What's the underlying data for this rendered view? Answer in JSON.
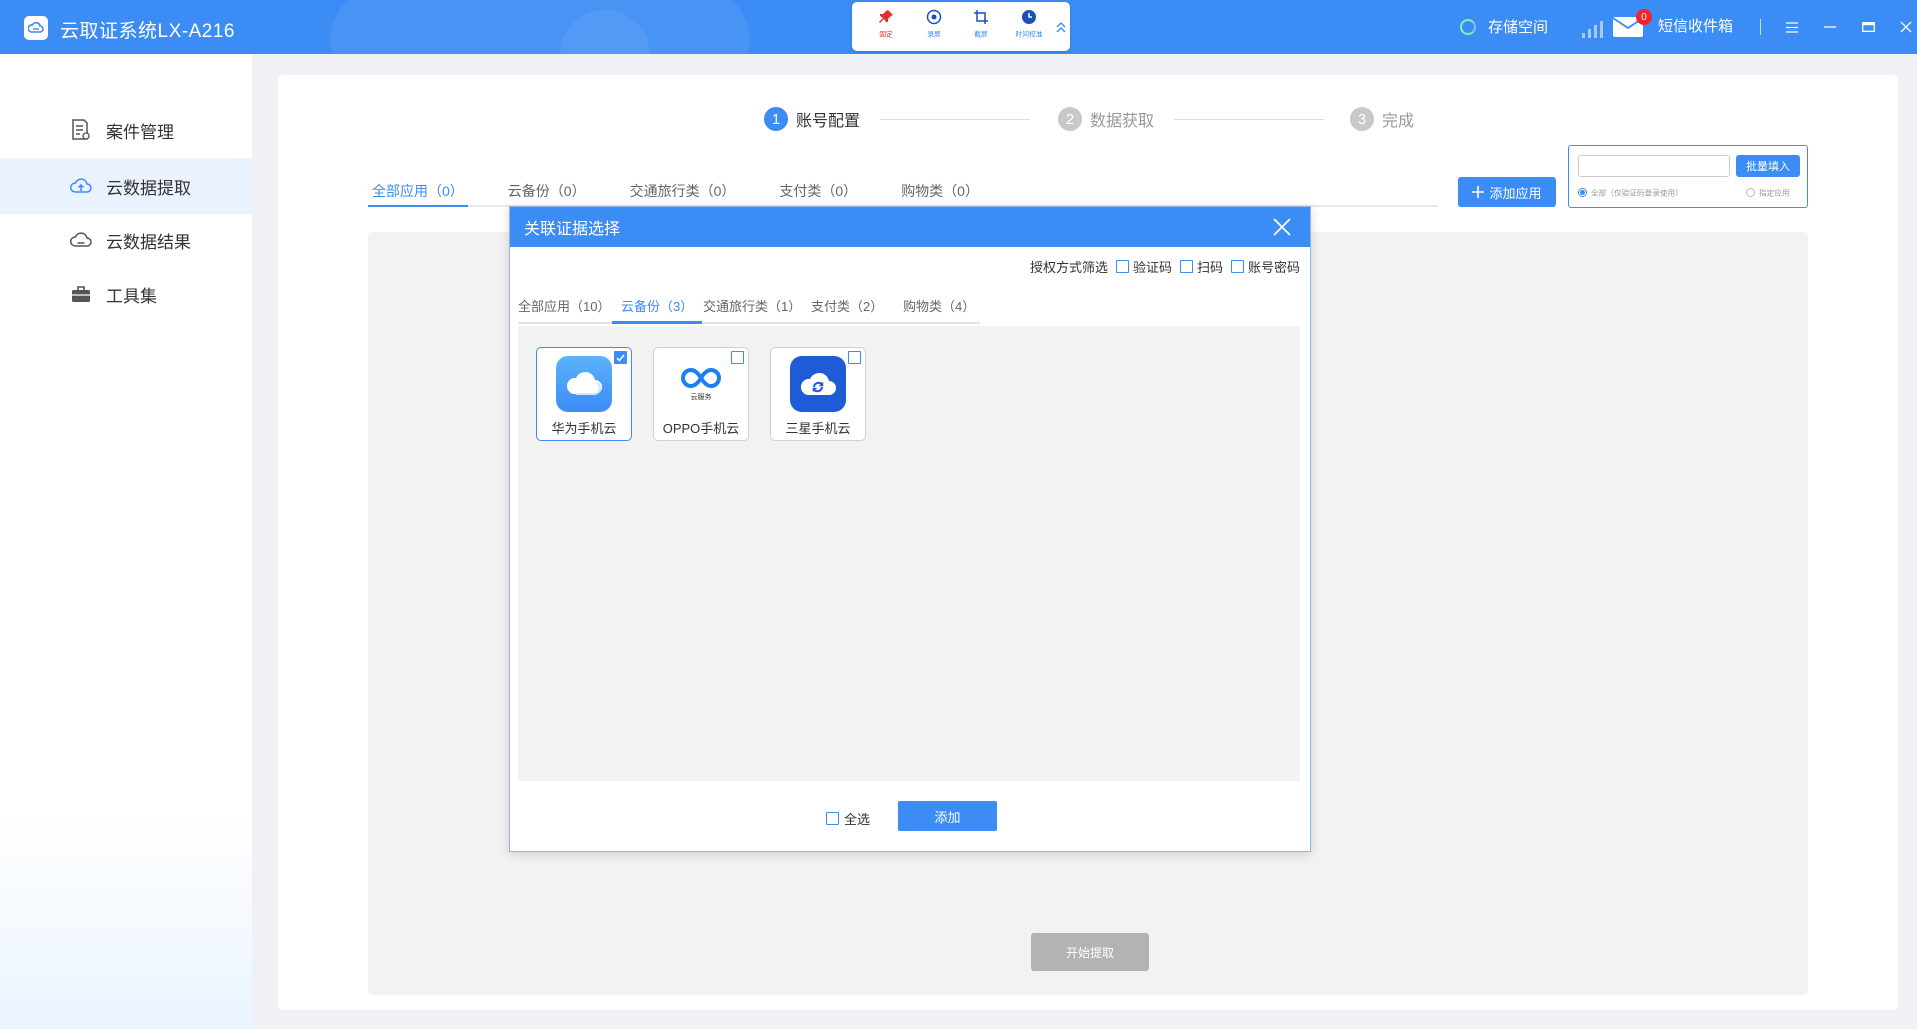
{
  "app": {
    "title": "云取证系统LX-A216"
  },
  "toolbar": {
    "items": [
      {
        "label": "固定",
        "icon": "pin-icon",
        "active": true
      },
      {
        "label": "录屏",
        "icon": "record-icon",
        "active": false
      },
      {
        "label": "截屏",
        "icon": "crop-icon",
        "active": false
      },
      {
        "label": "时间校准",
        "icon": "clock-icon",
        "active": false
      }
    ]
  },
  "header": {
    "storage_label": "存储空间",
    "sms_label": "短信收件箱",
    "sms_badge": "0"
  },
  "sidebar": {
    "items": [
      {
        "label": "案件管理",
        "icon": "case-document-icon",
        "active": false
      },
      {
        "label": "云数据提取",
        "icon": "cloud-upload-icon",
        "active": true
      },
      {
        "label": "云数据结果",
        "icon": "cloud-result-icon",
        "active": false
      },
      {
        "label": "工具集",
        "icon": "toolbox-icon",
        "active": false
      }
    ]
  },
  "steps": [
    {
      "num": "1",
      "label": "账号配置",
      "active": true
    },
    {
      "num": "2",
      "label": "数据获取",
      "active": false
    },
    {
      "num": "3",
      "label": "完成",
      "active": false
    }
  ],
  "main": {
    "tabs": [
      {
        "label": "全部应用（0）",
        "active": true
      },
      {
        "label": "云备份（0）",
        "active": false
      },
      {
        "label": "交通旅行类（0）",
        "active": false
      },
      {
        "label": "支付类（0）",
        "active": false
      },
      {
        "label": "购物类（0）",
        "active": false
      }
    ],
    "add_app_label": "添加应用",
    "batch": {
      "input_value": "",
      "button_label": "批量填入",
      "radio_all": "全部（仅验证码登录使用）",
      "radio_selected": "指定应用"
    },
    "start_label": "开始提取"
  },
  "modal": {
    "title": "关联证据选择",
    "filter_label": "授权方式筛选",
    "filters": [
      "验证码",
      "扫码",
      "账号密码"
    ],
    "tabs": [
      {
        "label": "全部应用（10）",
        "active": false
      },
      {
        "label": "云备份（3）",
        "active": true
      },
      {
        "label": "交通旅行类（1）",
        "active": false
      },
      {
        "label": "支付类（2）",
        "active": false
      },
      {
        "label": "购物类（4）",
        "active": false
      }
    ],
    "apps": [
      {
        "name": "华为手机云",
        "icon": "huawei-cloud-icon",
        "checked": true,
        "color": "#4fa3f7"
      },
      {
        "name": "OPPO手机云",
        "icon": "oppo-cloud-icon",
        "checked": false,
        "color": "#1a7ff0",
        "sub": "云服务"
      },
      {
        "name": "三星手机云",
        "icon": "samsung-cloud-icon",
        "checked": false,
        "color": "#1e5bd6"
      }
    ],
    "select_all_label": "全选",
    "add_label": "添加"
  },
  "colors": {
    "primary": "#3b8cf5",
    "badge": "#f5222d",
    "disabled": "#b3b3b3"
  }
}
